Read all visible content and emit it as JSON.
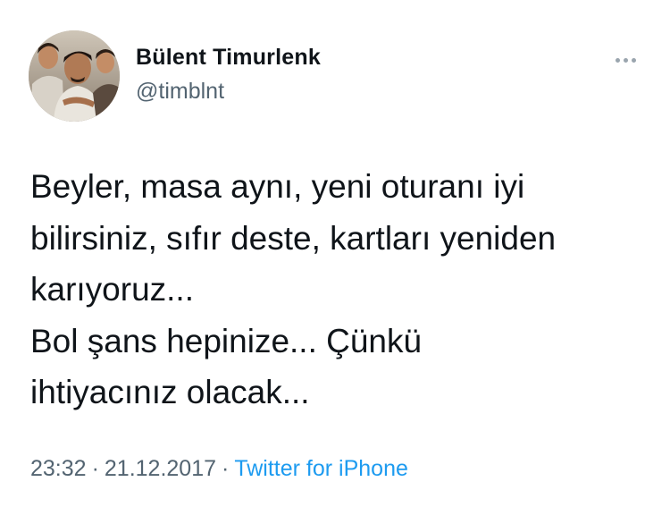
{
  "author": {
    "display_name": "Bülent Timurlenk",
    "handle": "@timblnt"
  },
  "tweet": {
    "lines": [
      "Beyler, masa aynı, yeni oturanı iyi",
      "bilirsiniz, sıfır deste, kartları yeniden",
      "karıyoruz...",
      "Bol şans hepinize... Çünkü",
      "ihtiyacınız olacak..."
    ]
  },
  "meta": {
    "time": "23:32",
    "separator": "·",
    "date": "21.12.2017",
    "source": "Twitter for iPhone"
  },
  "icons": {
    "more": "more-horizontal-icon"
  },
  "colors": {
    "text": "#0f1419",
    "secondary": "#536471",
    "link": "#1d9bf0"
  }
}
